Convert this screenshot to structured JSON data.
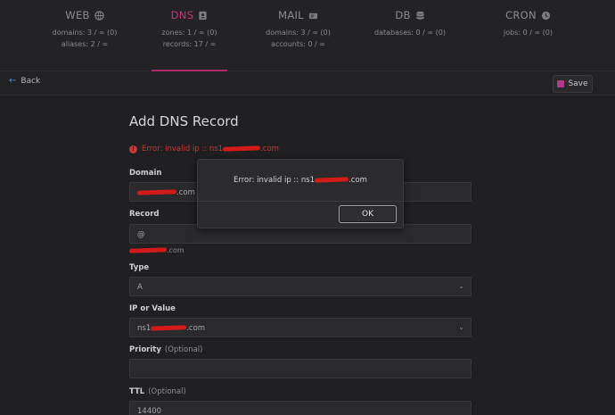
{
  "nav": {
    "web": {
      "label": "WEB",
      "stats": [
        "domains: 3 / ∞ (0)",
        "aliases: 2 / ∞"
      ]
    },
    "dns": {
      "label": "DNS",
      "stats": [
        "zones: 1 / ∞ (0)",
        "records: 17 / ∞"
      ]
    },
    "mail": {
      "label": "MAIL",
      "stats": [
        "domains: 3 / ∞ (0)",
        "accounts: 0 / ∞"
      ]
    },
    "db": {
      "label": "DB",
      "stats": [
        "databases: 0 / ∞ (0)"
      ]
    },
    "cron": {
      "label": "CRON",
      "stats": [
        "jobs: 0 / ∞ (0)"
      ]
    },
    "active_color": "#c5357a"
  },
  "toolbar": {
    "back_label": "Back",
    "save_label": "Save"
  },
  "form": {
    "title": "Add DNS Record",
    "error_prefix": "Error: invalid ip :: ns1",
    "error_suffix": ".com",
    "domain_label": "Domain",
    "domain_suffix": ".com",
    "record_label": "Record",
    "record_value": "@",
    "record_hint_suffix": ".com",
    "type_label": "Type",
    "type_value": "A",
    "ip_label": "IP or Value",
    "ip_prefix": "ns1",
    "ip_suffix": ".com",
    "priority_label": "Priority",
    "priority_optional": "(Optional)",
    "ttl_label": "TTL",
    "ttl_optional": "(Optional)",
    "ttl_value": "14400",
    "error_color": "#c63a3a"
  },
  "dialog": {
    "message_prefix": "Error: invalid ip :: ns1",
    "message_suffix": ".com",
    "ok_label": "OK"
  }
}
